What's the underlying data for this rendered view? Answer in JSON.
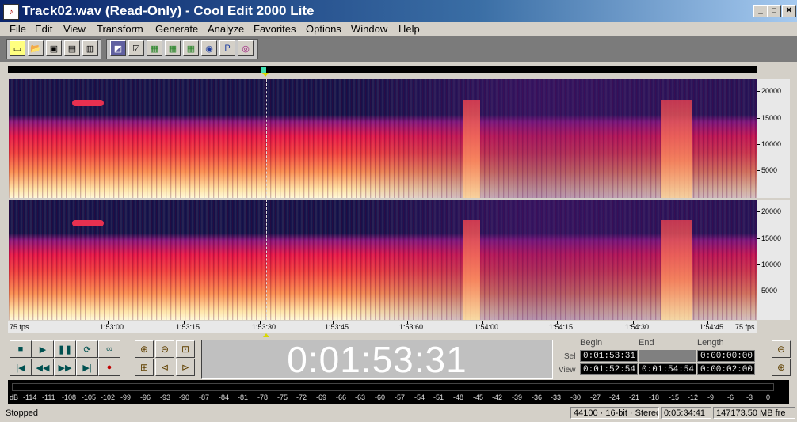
{
  "window": {
    "title": "Track02.wav (Read-Only) - Cool Edit 2000 Lite",
    "minimize": "_",
    "maximize": "□",
    "close": "✕"
  },
  "menu": [
    "File",
    "Edit",
    "View",
    "Transform",
    "Generate",
    "Analyze",
    "Favorites",
    "Options",
    "Window",
    "Help"
  ],
  "toolbar": {
    "icons": [
      "new-file-icon",
      "open-file-icon",
      "save-icon",
      "save-as-icon",
      "close-file-icon",
      "spectral-view-icon",
      "edit-icon",
      "grid-icon",
      "grid-icon",
      "grid-icon",
      "cd-icon",
      "page-icon",
      "playlist-icon"
    ]
  },
  "spectrogram": {
    "hz_labels": [
      "20000",
      "15000",
      "10000",
      "5000"
    ],
    "time_labels": [
      "75 fps",
      "1:53:00",
      "1:53:15",
      "1:53:30",
      "1:53:45",
      "1:53:60",
      "1:54:00",
      "1:54:15",
      "1:54:30",
      "1:54:45",
      "75 fps"
    ]
  },
  "transport": {
    "row1": [
      "■",
      "▶",
      "❚❚",
      "⟳",
      "∞"
    ],
    "row2": [
      "|◀",
      "◀◀",
      "▶▶",
      "▶|",
      "●"
    ]
  },
  "time_display": "0:01:53:31",
  "selection": {
    "headers": {
      "begin": "Begin",
      "end": "End",
      "length": "Length"
    },
    "sel_label": "Sel",
    "view_label": "View",
    "sel": {
      "begin": "0:01:53:31",
      "end": "",
      "length": "0:00:00:00"
    },
    "view": {
      "begin": "0:01:52:54",
      "end": "0:01:54:54",
      "length": "0:00:02:00"
    }
  },
  "meter": {
    "db_labels": [
      "dB",
      "-114",
      "-111",
      "-108",
      "-105",
      "-102",
      "-99",
      "-96",
      "-93",
      "-90",
      "-87",
      "-84",
      "-81",
      "-78",
      "-75",
      "-72",
      "-69",
      "-66",
      "-63",
      "-60",
      "-57",
      "-54",
      "-51",
      "-48",
      "-45",
      "-42",
      "-39",
      "-36",
      "-33",
      "-30",
      "-27",
      "-24",
      "-21",
      "-18",
      "-15",
      "-12",
      "-9",
      "-6",
      "-3",
      "0"
    ]
  },
  "status": {
    "state": "Stopped",
    "format": "44100 · 16-bit · Stereo",
    "duration": "0:05:34:41",
    "free": "147173.50 MB fre"
  }
}
